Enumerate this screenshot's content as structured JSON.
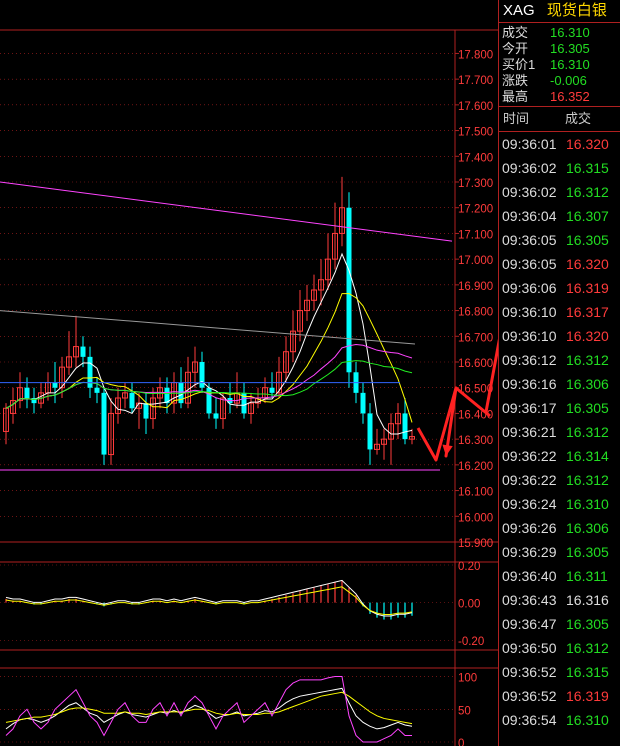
{
  "header": {
    "symbol": "XAG",
    "name": "现货白银"
  },
  "quotes": [
    {
      "label": "成交",
      "value": "16.310",
      "color": "#22dd22"
    },
    {
      "label": "今开",
      "value": "16.305",
      "color": "#22dd22"
    },
    {
      "label": "买价1",
      "value": "16.310",
      "color": "#22dd22"
    },
    {
      "label": "涨跌",
      "value": "-0.006",
      "color": "#22dd22"
    },
    {
      "label": "最高",
      "value": "16.352",
      "color": "#ff3b3b"
    }
  ],
  "ticks_header": {
    "time": "时间",
    "price": "成交"
  },
  "ticks": [
    {
      "time": "09:36:01",
      "price": "16.320",
      "dir": "up"
    },
    {
      "time": "09:36:02",
      "price": "16.315",
      "dir": "dn"
    },
    {
      "time": "09:36:02",
      "price": "16.312",
      "dir": "dn"
    },
    {
      "time": "09:36:04",
      "price": "16.307",
      "dir": "dn"
    },
    {
      "time": "09:36:05",
      "price": "16.305",
      "dir": "dn"
    },
    {
      "time": "09:36:05",
      "price": "16.320",
      "dir": "up"
    },
    {
      "time": "09:36:06",
      "price": "16.319",
      "dir": "up"
    },
    {
      "time": "09:36:10",
      "price": "16.317",
      "dir": "up"
    },
    {
      "time": "09:36:10",
      "price": "16.320",
      "dir": "up"
    },
    {
      "time": "09:36:12",
      "price": "16.312",
      "dir": "dn"
    },
    {
      "time": "09:36:16",
      "price": "16.306",
      "dir": "dn"
    },
    {
      "time": "09:36:17",
      "price": "16.305",
      "dir": "dn"
    },
    {
      "time": "09:36:21",
      "price": "16.312",
      "dir": "dn"
    },
    {
      "time": "09:36:22",
      "price": "16.314",
      "dir": "dn"
    },
    {
      "time": "09:36:22",
      "price": "16.312",
      "dir": "dn"
    },
    {
      "time": "09:36:24",
      "price": "16.310",
      "dir": "dn"
    },
    {
      "time": "09:36:26",
      "price": "16.306",
      "dir": "dn"
    },
    {
      "time": "09:36:29",
      "price": "16.305",
      "dir": "dn"
    },
    {
      "time": "09:36:40",
      "price": "16.311",
      "dir": "dn"
    },
    {
      "time": "09:36:43",
      "price": "16.316",
      "dir": "eq"
    },
    {
      "time": "09:36:47",
      "price": "16.305",
      "dir": "dn"
    },
    {
      "time": "09:36:50",
      "price": "16.312",
      "dir": "dn"
    },
    {
      "time": "09:36:52",
      "price": "16.315",
      "dir": "dn"
    },
    {
      "time": "09:36:52",
      "price": "16.319",
      "dir": "up"
    },
    {
      "time": "09:36:54",
      "price": "16.310",
      "dir": "dn"
    }
  ],
  "colors": {
    "up": "#ff3b3b",
    "dn": "#22dd22",
    "eq": "#dddddd",
    "grid": "#b02020",
    "cyan": "#00ffff",
    "annotation": "#ff2222"
  },
  "chart_data": {
    "type": "candlestick",
    "price_axis": {
      "ticks": [
        "17.800",
        "17.700",
        "17.600",
        "17.500",
        "17.400",
        "17.300",
        "17.200",
        "17.100",
        "17.000",
        "16.900",
        "16.800",
        "16.700",
        "16.600",
        "16.500",
        "16.400",
        "16.300",
        "16.200",
        "16.100",
        "16.000",
        "15.900"
      ],
      "ylim": [
        15.9,
        17.86
      ]
    },
    "macd_axis": {
      "ticks": [
        "0.20",
        "0.00",
        "-0.20"
      ],
      "ylim": [
        -0.22,
        0.2
      ]
    },
    "kdj_axis": {
      "ticks": [
        "100",
        "50",
        "0"
      ],
      "ylim": [
        0,
        110
      ]
    },
    "candles": [
      [
        16.33,
        16.42,
        16.28,
        16.44
      ],
      [
        16.4,
        16.45,
        16.36,
        16.5
      ],
      [
        16.45,
        16.5,
        16.42,
        16.56
      ],
      [
        16.5,
        16.46,
        16.42,
        16.54
      ],
      [
        16.46,
        16.44,
        16.4,
        16.5
      ],
      [
        16.44,
        16.48,
        16.42,
        16.52
      ],
      [
        16.48,
        16.52,
        16.45,
        16.56
      ],
      [
        16.52,
        16.5,
        16.44,
        16.6
      ],
      [
        16.5,
        16.58,
        16.46,
        16.62
      ],
      [
        16.58,
        16.62,
        16.55,
        16.72
      ],
      [
        16.62,
        16.66,
        16.58,
        16.78
      ],
      [
        16.66,
        16.62,
        16.58,
        16.7
      ],
      [
        16.62,
        16.5,
        16.46,
        16.66
      ],
      [
        16.5,
        16.48,
        16.44,
        16.54
      ],
      [
        16.48,
        16.24,
        16.2,
        16.5
      ],
      [
        16.24,
        16.4,
        16.2,
        16.46
      ],
      [
        16.4,
        16.46,
        16.36,
        16.5
      ],
      [
        16.46,
        16.48,
        16.42,
        16.52
      ],
      [
        16.48,
        16.42,
        16.4,
        16.52
      ],
      [
        16.42,
        16.44,
        16.34,
        16.48
      ],
      [
        16.44,
        16.38,
        16.32,
        16.48
      ],
      [
        16.38,
        16.46,
        16.34,
        16.5
      ],
      [
        16.46,
        16.5,
        16.42,
        16.54
      ],
      [
        16.5,
        16.44,
        16.4,
        16.54
      ],
      [
        16.44,
        16.52,
        16.4,
        16.56
      ],
      [
        16.52,
        16.44,
        16.42,
        16.58
      ],
      [
        16.44,
        16.56,
        16.42,
        16.62
      ],
      [
        16.56,
        16.6,
        16.5,
        16.66
      ],
      [
        16.6,
        16.5,
        16.48,
        16.64
      ],
      [
        16.5,
        16.4,
        16.38,
        16.52
      ],
      [
        16.4,
        16.38,
        16.34,
        16.46
      ],
      [
        16.38,
        16.46,
        16.34,
        16.48
      ],
      [
        16.46,
        16.44,
        16.4,
        16.52
      ],
      [
        16.44,
        16.48,
        16.42,
        16.56
      ],
      [
        16.48,
        16.4,
        16.38,
        16.52
      ],
      [
        16.4,
        16.44,
        16.36,
        16.48
      ],
      [
        16.44,
        16.46,
        16.42,
        16.5
      ],
      [
        16.46,
        16.5,
        16.44,
        16.54
      ],
      [
        16.5,
        16.48,
        16.46,
        16.56
      ],
      [
        16.48,
        16.56,
        16.46,
        16.62
      ],
      [
        16.56,
        16.64,
        16.52,
        16.7
      ],
      [
        16.64,
        16.72,
        16.6,
        16.8
      ],
      [
        16.72,
        16.8,
        16.68,
        16.88
      ],
      [
        16.8,
        16.84,
        16.76,
        16.9
      ],
      [
        16.84,
        16.88,
        16.8,
        16.94
      ],
      [
        16.88,
        16.92,
        16.82,
        17.0
      ],
      [
        16.92,
        17.0,
        16.88,
        17.1
      ],
      [
        17.0,
        17.1,
        16.96,
        17.22
      ],
      [
        17.1,
        17.2,
        17.05,
        17.32
      ],
      [
        17.2,
        16.56,
        16.5,
        17.26
      ],
      [
        16.56,
        16.48,
        16.44,
        16.6
      ],
      [
        16.48,
        16.4,
        16.36,
        16.52
      ],
      [
        16.4,
        16.26,
        16.2,
        16.44
      ],
      [
        16.26,
        16.28,
        16.24,
        16.34
      ],
      [
        16.28,
        16.3,
        16.22,
        16.34
      ],
      [
        16.3,
        16.36,
        16.2,
        16.4
      ],
      [
        16.36,
        16.4,
        16.3,
        16.44
      ],
      [
        16.4,
        16.3,
        16.28,
        16.46
      ],
      [
        16.3,
        16.31,
        16.28,
        16.34
      ]
    ],
    "macd_bars": [
      0.02,
      0.01,
      0.01,
      0.0,
      -0.01,
      -0.01,
      0.0,
      0.01,
      0.01,
      0.02,
      0.02,
      0.01,
      0.0,
      -0.01,
      -0.02,
      -0.01,
      0.0,
      0.0,
      -0.01,
      -0.01,
      0.0,
      0.01,
      0.01,
      0.0,
      0.01,
      0.0,
      0.01,
      0.02,
      0.01,
      0.0,
      -0.01,
      0.0,
      0.0,
      0.0,
      -0.01,
      0.0,
      0.0,
      0.01,
      0.02,
      0.03,
      0.04,
      0.05,
      0.06,
      0.07,
      0.08,
      0.09,
      0.1,
      0.11,
      0.12,
      0.08,
      0.04,
      -0.02,
      -0.06,
      -0.08,
      -0.09,
      -0.09,
      -0.08,
      -0.08,
      -0.07
    ],
    "kdj_k": [
      20,
      28,
      34,
      36,
      34,
      30,
      34,
      40,
      48,
      56,
      60,
      52,
      44,
      40,
      30,
      36,
      42,
      46,
      42,
      40,
      38,
      42,
      46,
      44,
      48,
      44,
      50,
      56,
      52,
      44,
      36,
      40,
      42,
      46,
      40,
      42,
      44,
      48,
      46,
      52,
      60,
      66,
      70,
      72,
      74,
      76,
      78,
      80,
      82,
      60,
      40,
      30,
      24,
      20,
      22,
      26,
      30,
      26,
      24
    ],
    "kdj_d": [
      30,
      32,
      34,
      36,
      38,
      38,
      40,
      42,
      46,
      50,
      52,
      52,
      50,
      48,
      44,
      44,
      44,
      46,
      44,
      44,
      42,
      44,
      46,
      46,
      46,
      46,
      48,
      50,
      50,
      48,
      44,
      42,
      42,
      44,
      42,
      42,
      42,
      44,
      44,
      46,
      50,
      54,
      58,
      62,
      66,
      70,
      72,
      74,
      76,
      70,
      62,
      54,
      46,
      40,
      36,
      34,
      32,
      30,
      28
    ],
    "kdj_j": [
      10,
      20,
      40,
      50,
      30,
      20,
      30,
      50,
      60,
      70,
      80,
      60,
      40,
      30,
      10,
      30,
      50,
      60,
      40,
      30,
      30,
      50,
      60,
      40,
      60,
      40,
      60,
      70,
      60,
      40,
      20,
      40,
      50,
      60,
      30,
      40,
      50,
      60,
      40,
      60,
      80,
      90,
      95,
      95,
      95,
      95,
      98,
      100,
      100,
      40,
      10,
      0,
      0,
      0,
      5,
      10,
      20,
      10,
      10
    ]
  }
}
